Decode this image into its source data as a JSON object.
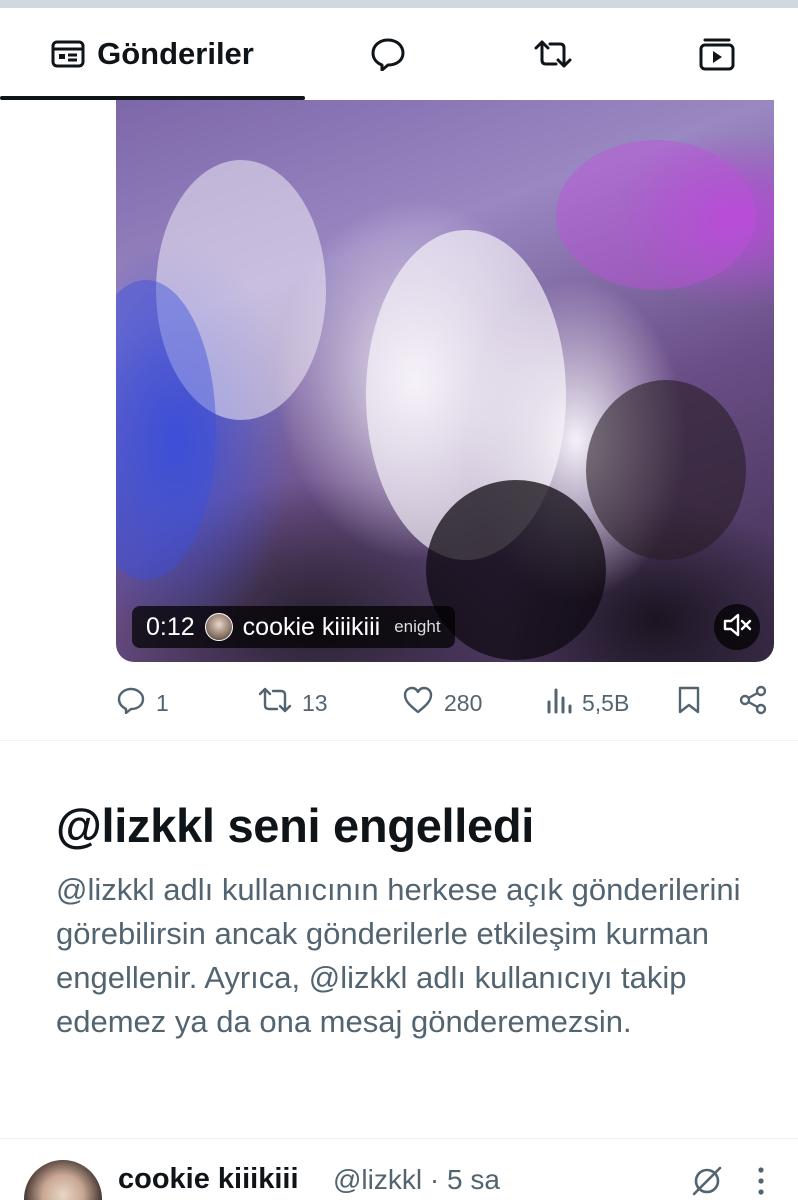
{
  "tabs": [
    {
      "label": "Gönderiler",
      "icon": "posts-icon",
      "active": true
    },
    {
      "label": "",
      "icon": "replies-icon",
      "active": false
    },
    {
      "label": "",
      "icon": "reposts-icon",
      "active": false
    },
    {
      "label": "",
      "icon": "media-icon",
      "active": false
    }
  ],
  "media": {
    "timestamp": "0:12",
    "author": "cookie kiiikiii",
    "watermark": "enight"
  },
  "actions": {
    "replies": "1",
    "reposts": "13",
    "likes": "280",
    "views": "5,5B"
  },
  "blocked": {
    "title": "@lizkkl seni engelledi",
    "body": "@lizkkl adlı kullanıcının herkese açık gönderilerini görebilirsin ancak gönderilerle etkileşim kurman engellenir. Ayrıca, @lizkkl adlı kullanıcıyı takip edemez ya da ona mesaj gönderemezsin."
  },
  "next_post": {
    "name": "cookie kiiikiii",
    "handle_time": "@lizkkl · 5 sa"
  },
  "colors": {
    "text_primary": "#0f1419",
    "text_secondary": "#536471",
    "divider": "#eff3f4"
  }
}
